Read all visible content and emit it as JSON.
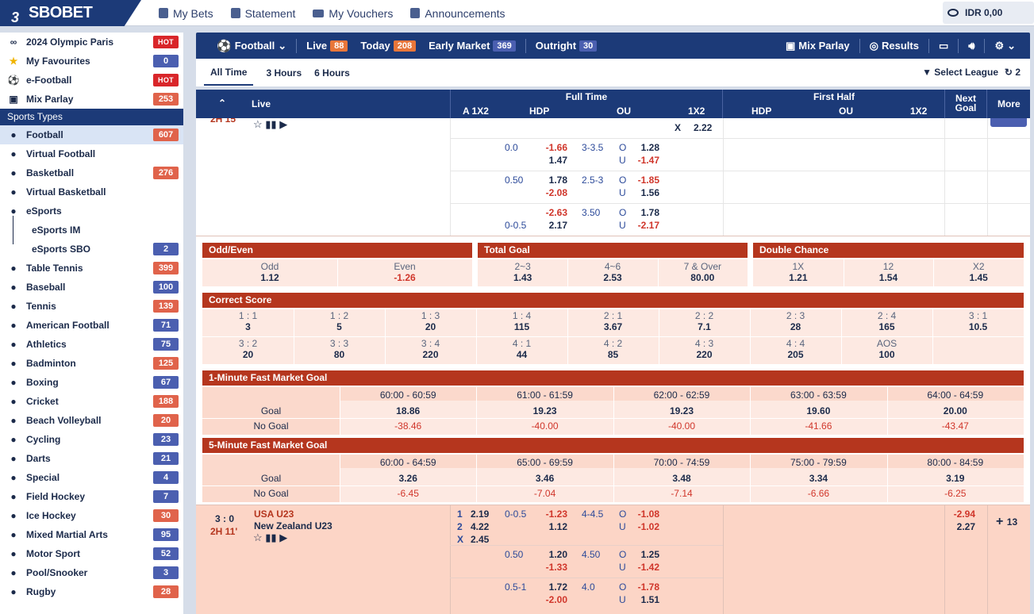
{
  "topbar": {
    "brand": "SBOBET",
    "nav": [
      "My Bets",
      "Statement",
      "My Vouchers",
      "Announcements"
    ],
    "balance": "IDR 0,00"
  },
  "sidebar": {
    "top": [
      {
        "label": "2024 Olympic Paris",
        "badge": "HOT",
        "kind": "hot",
        "icon": "olympic-rings-icon"
      },
      {
        "label": "My Favourites",
        "badge": "0",
        "kind": "blue",
        "icon": "star-icon"
      },
      {
        "label": "e-Football",
        "badge": "HOT",
        "kind": "hot",
        "icon": "soccer-ball-icon"
      },
      {
        "label": "Mix Parlay",
        "badge": "253",
        "kind": "red",
        "icon": "mix-parlay-icon"
      }
    ],
    "section": "Sports Types",
    "sports": [
      {
        "label": "Football",
        "badge": "607",
        "kind": "red"
      },
      {
        "label": "Virtual Football",
        "badge": "",
        "kind": ""
      },
      {
        "label": "Basketball",
        "badge": "276",
        "kind": "red"
      },
      {
        "label": "Virtual Basketball",
        "badge": "",
        "kind": ""
      },
      {
        "label": "eSports",
        "badge": "",
        "kind": ""
      },
      {
        "label": "eSports IM",
        "badge": "",
        "kind": "",
        "sub": true
      },
      {
        "label": "eSports SBO",
        "badge": "2",
        "kind": "blue",
        "sub": true
      },
      {
        "label": "Table Tennis",
        "badge": "399",
        "kind": "red"
      },
      {
        "label": "Baseball",
        "badge": "100",
        "kind": "blue"
      },
      {
        "label": "Tennis",
        "badge": "139",
        "kind": "red"
      },
      {
        "label": "American Football",
        "badge": "71",
        "kind": "blue"
      },
      {
        "label": "Athletics",
        "badge": "75",
        "kind": "blue"
      },
      {
        "label": "Badminton",
        "badge": "125",
        "kind": "red"
      },
      {
        "label": "Boxing",
        "badge": "67",
        "kind": "blue"
      },
      {
        "label": "Cricket",
        "badge": "188",
        "kind": "red"
      },
      {
        "label": "Beach Volleyball",
        "badge": "20",
        "kind": "red"
      },
      {
        "label": "Cycling",
        "badge": "23",
        "kind": "blue"
      },
      {
        "label": "Darts",
        "badge": "21",
        "kind": "blue"
      },
      {
        "label": "Special",
        "badge": "4",
        "kind": "blue"
      },
      {
        "label": "Field Hockey",
        "badge": "7",
        "kind": "blue"
      },
      {
        "label": "Ice Hockey",
        "badge": "30",
        "kind": "red"
      },
      {
        "label": "Mixed Martial Arts",
        "badge": "95",
        "kind": "blue"
      },
      {
        "label": "Motor Sport",
        "badge": "52",
        "kind": "blue"
      },
      {
        "label": "Pool/Snooker",
        "badge": "3",
        "kind": "blue"
      },
      {
        "label": "Rugby",
        "badge": "28",
        "kind": "red"
      }
    ]
  },
  "bar": {
    "sport": "Football",
    "live": "Live",
    "live_count": "88",
    "today": "Today",
    "today_count": "208",
    "early": "Early Market",
    "early_count": "369",
    "outright": "Outright",
    "outright_count": "30",
    "mix": "Mix Parlay",
    "results": "Results"
  },
  "filter": {
    "options": [
      "All Time",
      "3 Hours",
      "6 Hours"
    ],
    "select_league": "Select League",
    "refresh_count": "2"
  },
  "header": {
    "live": "Live",
    "full_time": "Full Time",
    "first_half": "First Half",
    "next_goal": "Next Goal",
    "more": "More",
    "ft_cols": [
      "A 1X2",
      "HDP",
      "OU",
      "1X2"
    ],
    "fh_cols": [
      "HDP",
      "OU",
      "1X2"
    ]
  },
  "match1": {
    "time_partial": "2H 15'",
    "x_label": "X",
    "x_odds": "2.22",
    "lines": [
      {
        "hdp": "0.0",
        "h1": "-1.66",
        "h2": "1.47",
        "ou": "3-3.5",
        "o": "1.28",
        "u": "-1.47"
      },
      {
        "hdp": "0.50",
        "h1": "1.78",
        "h2": "-2.08",
        "ou": "2.5-3",
        "o": "-1.85",
        "u": "1.56"
      },
      {
        "hdp": "0-0.5",
        "h1": "-2.63",
        "h2": "2.17",
        "ou": "3.50",
        "o": "1.78",
        "u": "-2.17"
      }
    ]
  },
  "odd_even": {
    "title": "Odd/Even",
    "items": [
      {
        "l": "Odd",
        "v": "1.12"
      },
      {
        "l": "Even",
        "v": "-1.26"
      }
    ]
  },
  "total_goal": {
    "title": "Total Goal",
    "items": [
      {
        "l": "2~3",
        "v": "1.43"
      },
      {
        "l": "4~6",
        "v": "2.53"
      },
      {
        "l": "7 & Over",
        "v": "80.00"
      }
    ]
  },
  "double_chance": {
    "title": "Double Chance",
    "items": [
      {
        "l": "1X",
        "v": "1.21"
      },
      {
        "l": "12",
        "v": "1.54"
      },
      {
        "l": "X2",
        "v": "1.45"
      }
    ]
  },
  "correct_score": {
    "title": "Correct Score",
    "rows": [
      [
        {
          "l": "1 : 1",
          "v": "3"
        },
        {
          "l": "1 : 2",
          "v": "5"
        },
        {
          "l": "1 : 3",
          "v": "20"
        },
        {
          "l": "1 : 4",
          "v": "115"
        },
        {
          "l": "2 : 1",
          "v": "3.67"
        },
        {
          "l": "2 : 2",
          "v": "7.1"
        },
        {
          "l": "2 : 3",
          "v": "28"
        },
        {
          "l": "2 : 4",
          "v": "165"
        },
        {
          "l": "3 : 1",
          "v": "10.5"
        }
      ],
      [
        {
          "l": "3 : 2",
          "v": "20"
        },
        {
          "l": "3 : 3",
          "v": "80"
        },
        {
          "l": "3 : 4",
          "v": "220"
        },
        {
          "l": "4 : 1",
          "v": "44"
        },
        {
          "l": "4 : 2",
          "v": "85"
        },
        {
          "l": "4 : 3",
          "v": "220"
        },
        {
          "l": "4 : 4",
          "v": "205"
        },
        {
          "l": "AOS",
          "v": "100"
        },
        {
          "l": "",
          "v": ""
        }
      ]
    ]
  },
  "fast1": {
    "title": "1-Minute Fast Market Goal",
    "cols": [
      "60:00 - 60:59",
      "61:00 - 61:59",
      "62:00 - 62:59",
      "63:00 - 63:59",
      "64:00 - 64:59"
    ],
    "goal_label": "Goal",
    "nogoal_label": "No Goal",
    "goal": [
      "18.86",
      "19.23",
      "19.23",
      "19.60",
      "20.00"
    ],
    "nogoal": [
      "-38.46",
      "-40.00",
      "-40.00",
      "-41.66",
      "-43.47"
    ]
  },
  "fast5": {
    "title": "5-Minute Fast Market Goal",
    "cols": [
      "60:00 - 64:59",
      "65:00 - 69:59",
      "70:00 - 74:59",
      "75:00 - 79:59",
      "80:00 - 84:59"
    ],
    "goal_label": "Goal",
    "nogoal_label": "No Goal",
    "goal": [
      "3.26",
      "3.46",
      "3.48",
      "3.34",
      "3.19"
    ],
    "nogoal": [
      "-6.45",
      "-7.04",
      "-7.14",
      "-6.66",
      "-6.25"
    ]
  },
  "match2": {
    "score": "3 : 0",
    "time": "2H 11'",
    "home": "USA U23",
    "away": "New Zealand U23",
    "x12": [
      {
        "k": "1",
        "v": "2.19"
      },
      {
        "k": "2",
        "v": "4.22"
      },
      {
        "k": "X",
        "v": "2.45"
      }
    ],
    "lines": [
      {
        "hdp": "0-0.5",
        "h1": "-1.23",
        "h2": "1.12",
        "ou": "4-4.5",
        "o": "-1.08",
        "u": "-1.02"
      },
      {
        "hdp": "0.50",
        "h1": "1.20",
        "h2": "-1.33",
        "ou": "4.50",
        "o": "1.25",
        "u": "-1.42"
      },
      {
        "hdp": "0.5-1",
        "h1": "1.72",
        "h2": "-2.00",
        "ou": "4.0",
        "o": "-1.78",
        "u": "1.51"
      }
    ],
    "next_goal": [
      "-2.94",
      "2.27"
    ],
    "more": "13"
  }
}
